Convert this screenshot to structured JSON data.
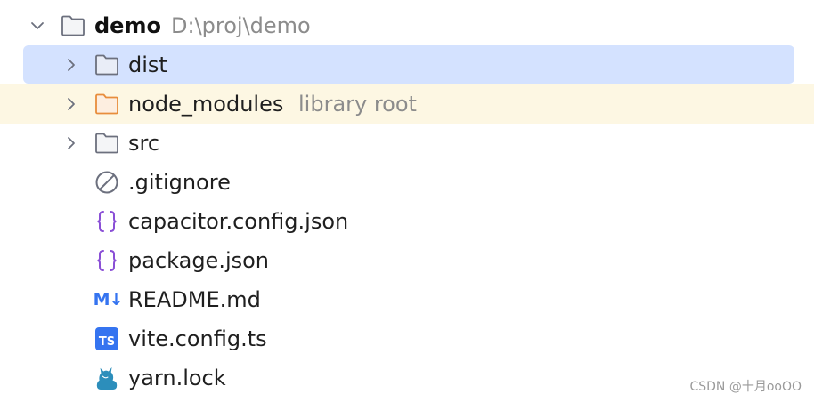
{
  "tree": {
    "root": {
      "name": "demo",
      "path": "D:\\proj\\demo",
      "icon": "folder-icon",
      "expanded": true
    },
    "items": [
      {
        "name": "dist",
        "type": "folder",
        "icon": "folder-icon",
        "selected": true
      },
      {
        "name": "node_modules",
        "type": "folder",
        "icon": "folder-orange-icon",
        "hint": "library root"
      },
      {
        "name": "src",
        "type": "folder",
        "icon": "folder-icon"
      },
      {
        "name": ".gitignore",
        "type": "file",
        "icon": "ignored-file-icon"
      },
      {
        "name": "capacitor.config.json",
        "type": "file",
        "icon": "json-braces-icon"
      },
      {
        "name": "package.json",
        "type": "file",
        "icon": "json-braces-icon"
      },
      {
        "name": "README.md",
        "type": "file",
        "icon": "markdown-icon"
      },
      {
        "name": "vite.config.ts",
        "type": "file",
        "icon": "typescript-icon"
      },
      {
        "name": "yarn.lock",
        "type": "file",
        "icon": "yarn-cat-icon"
      }
    ]
  },
  "icon_text": {
    "markdown": "M↓",
    "typescript": "TS"
  },
  "colors": {
    "selection": "#d4e2ff",
    "library_row": "#fdf7e3",
    "folder_outline": "#6c707e",
    "library_folder": "#e88d3c",
    "json_icon": "#8a4fd6",
    "markdown_icon": "#3574f0",
    "ts_icon": "#3574f0",
    "yarn_icon": "#2c8ebb"
  },
  "watermark": "CSDN @十月ooOO"
}
